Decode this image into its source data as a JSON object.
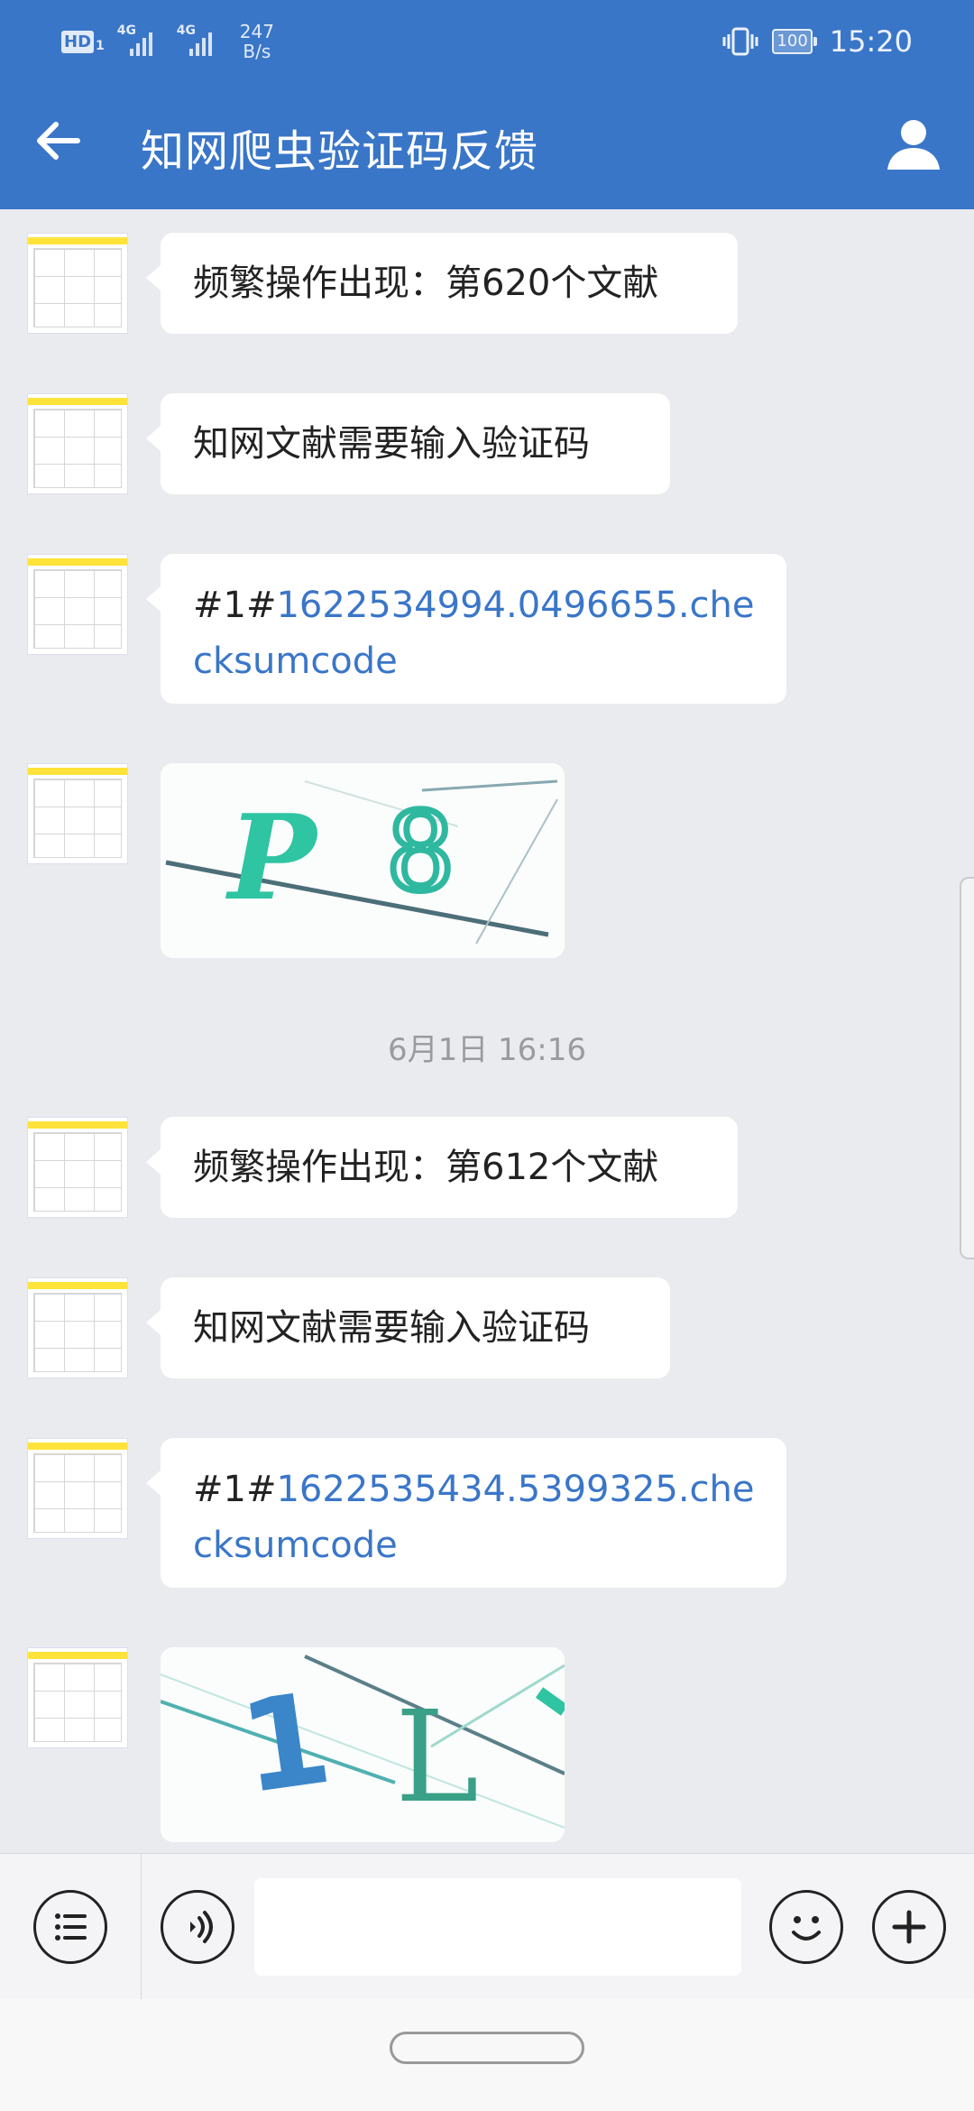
{
  "status_bar": {
    "hd_label": "HD",
    "hd_sub": "1",
    "signal1_label": "4G",
    "signal2_label": "4G",
    "speed_value": "247",
    "speed_unit": "B/s",
    "battery": "100",
    "time": "15:20"
  },
  "header": {
    "title": "知网爬虫验证码反馈",
    "back_icon": "arrow-left-icon",
    "profile_icon": "user-icon"
  },
  "messages": [
    {
      "type": "text",
      "text": "频繁操作出现：第620个文献"
    },
    {
      "type": "text",
      "text": "知网文献需要输入验证码"
    },
    {
      "type": "link",
      "prefix": "#1#",
      "line1": "1622534994.0496655.che",
      "line2": "cksumcode"
    },
    {
      "type": "image",
      "captcha_text": "P8"
    },
    {
      "type": "timestamp",
      "text": "6月1日  16:16"
    },
    {
      "type": "text",
      "text": "频繁操作出现：第612个文献"
    },
    {
      "type": "text",
      "text": "知网文献需要输入验证码"
    },
    {
      "type": "link",
      "prefix": "#1#",
      "line1": "1622535434.5399325.che",
      "line2": "cksumcode"
    },
    {
      "type": "image",
      "captcha_text": "1L"
    }
  ],
  "input_bar": {
    "menu_icon": "list-menu-icon",
    "voice_icon": "voice-icon",
    "emoji_icon": "smiley-icon",
    "plus_icon": "plus-icon",
    "input_value": ""
  },
  "colors": {
    "header_bg": "#3a76c8",
    "chat_bg": "#eaebee",
    "link": "#3a76c8"
  }
}
